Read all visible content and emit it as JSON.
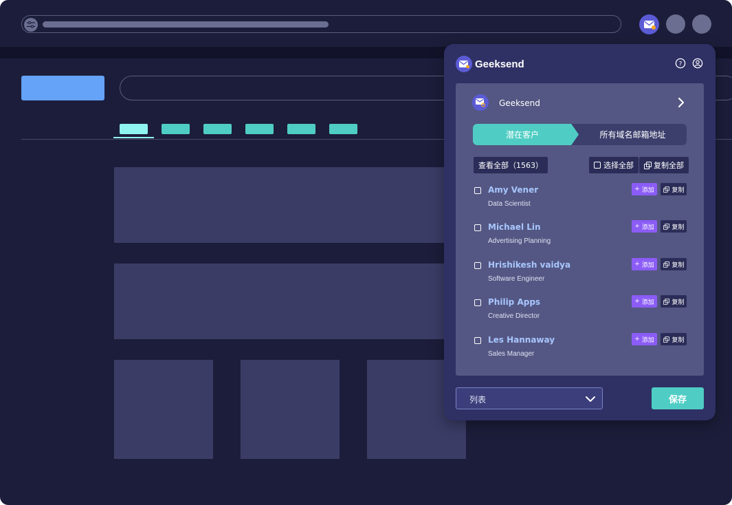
{
  "browser": {
    "icons": [
      "settings-sliders-icon",
      "geeksend-mail-icon",
      "extension-icon"
    ]
  },
  "extension": {
    "brand_name": "Geeksend",
    "header_icons": [
      "help-icon",
      "account-icon"
    ],
    "site": {
      "name": "Geeksend",
      "icon": "chevron-right-icon"
    },
    "tabs": [
      {
        "label": "潜在客户",
        "active": true
      },
      {
        "label": "所有域名邮箱地址",
        "active": false
      }
    ],
    "view_all_label": "查看全部（1563）",
    "select_all_label": "选择全部",
    "copy_all_label": "复制全部",
    "contacts": [
      {
        "name": "Amy Vener",
        "title": "Data Scientist",
        "add_label": "添加",
        "copy_label": "复制"
      },
      {
        "name": "Michael Lin",
        "title": "Advertising Planning",
        "add_label": "添加",
        "copy_label": "复制"
      },
      {
        "name": "Hrishikesh vaidya",
        "title": "Software Engineer",
        "add_label": "添加",
        "copy_label": "复制"
      },
      {
        "name": "Philip Apps",
        "title": "Creative Director",
        "add_label": "添加",
        "copy_label": "复制"
      },
      {
        "name": "Les Hannaway",
        "title": "Sales Manager",
        "add_label": "添加",
        "copy_label": "复制"
      }
    ],
    "list_select": {
      "value": "列表",
      "icon": "chevron-down-icon"
    },
    "save_label": "保存",
    "colors": {
      "accent_teal": "#4fcdc4",
      "add_purple": "#8b5cf6",
      "panel_bg": "#2f3064",
      "name_blue": "#a8c6ff"
    }
  }
}
